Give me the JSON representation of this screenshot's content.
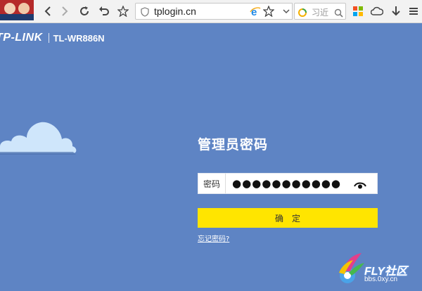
{
  "browser": {
    "url": "tplogin.cn",
    "search_placeholder": "习近"
  },
  "header": {
    "logo": "TP-LINK",
    "model": "TL-WR886N"
  },
  "login": {
    "title": "管理员密码",
    "password_label": "密码",
    "password_value": "●●●●●●●●●●●",
    "confirm_label": "确定",
    "forgot_link": "忘记密码?"
  },
  "watermark": {
    "brand": "FLY社区",
    "site": "bbs.0xy.cn"
  },
  "colors": {
    "page_bg": "#5e84c4",
    "confirm_button": "#ffe500",
    "cloud": "#cfe6fb"
  },
  "icons": [
    "back-icon",
    "forward-icon",
    "reload-icon",
    "undo-icon",
    "star-icon",
    "shield-icon",
    "ie-icon",
    "chevron-down-icon",
    "search-icon",
    "apps-icon",
    "cloud-icon",
    "download-icon",
    "menu-icon",
    "eye-icon"
  ]
}
